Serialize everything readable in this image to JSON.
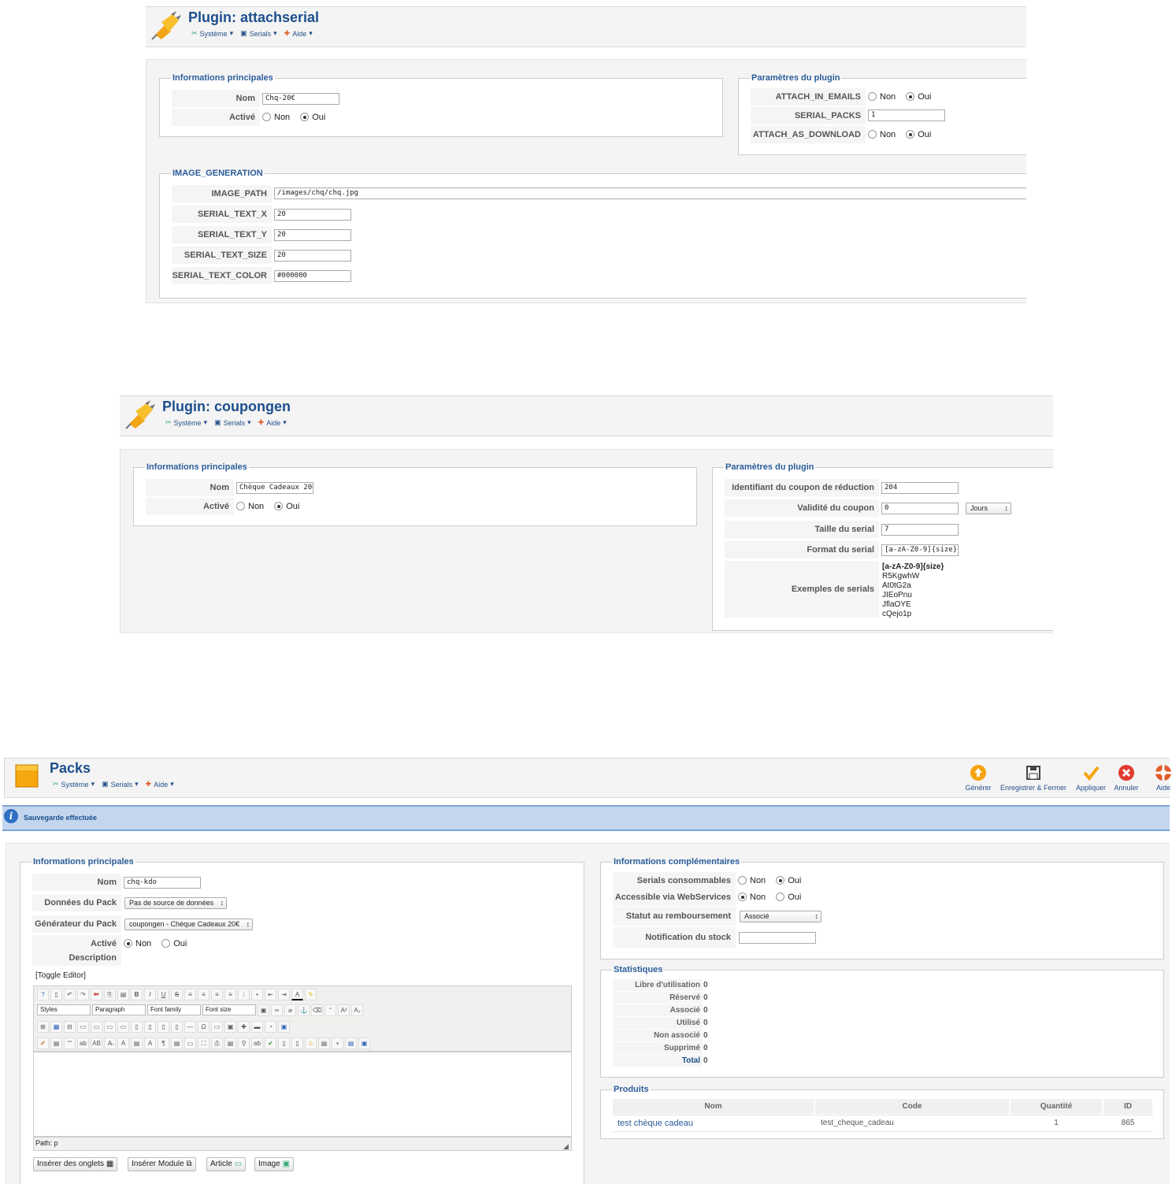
{
  "plugin1": {
    "title": "Plugin: attachserial",
    "menu": [
      "Système",
      "Serials",
      "Aide"
    ],
    "info": {
      "legend": "Informations principales",
      "nom_label": "Nom",
      "nom_value": "Chq-20€",
      "active_label": "Activé",
      "non": "Non",
      "oui": "Oui"
    },
    "params": {
      "legend": "Paramètres du plugin",
      "attach_in_emails": "ATTACH_IN_EMAILS",
      "serial_packs": "SERIAL_PACKS",
      "serial_packs_value": "1",
      "attach_as_download": "ATTACH_AS_DOWNLOAD",
      "non": "Non",
      "oui": "Oui"
    },
    "image": {
      "legend": "IMAGE_GENERATION",
      "image_path_label": "IMAGE_PATH",
      "image_path_value": "/images/chq/chq.jpg",
      "text_x_label": "SERIAL_TEXT_X",
      "text_x_value": "20",
      "text_y_label": "SERIAL_TEXT_Y",
      "text_y_value": "20",
      "text_size_label": "SERIAL_TEXT_SIZE",
      "text_size_value": "20",
      "text_color_label": "SERIAL_TEXT_COLOR",
      "text_color_value": "#000000"
    }
  },
  "plugin2": {
    "title": "Plugin: coupongen",
    "menu": [
      "Système",
      "Serials",
      "Aide"
    ],
    "info": {
      "legend": "Informations principales",
      "nom_label": "Nom",
      "nom_value": "Chèque Cadeaux 20€",
      "active_label": "Activé",
      "non": "Non",
      "oui": "Oui"
    },
    "params": {
      "legend": "Paramètres du plugin",
      "id_label": "Identifiant du coupon de réduction",
      "id_value": "204",
      "validite_label": "Validité du coupon",
      "validite_value": "0",
      "validite_unit": "Jours",
      "taille_label": "Taille du serial",
      "taille_value": "7",
      "format_label": "Format du serial",
      "format_value": "[a-zA-Z0-9]{size}",
      "exemples_label": "Exemples de serials",
      "exemples_head": "[a-zA-Z0-9]{size}",
      "exemples": [
        "R5KgwhW",
        "At0tG2a",
        "JIEoPnu",
        "JflaOYE",
        "cQejo1p"
      ]
    }
  },
  "packs": {
    "title": "Packs",
    "menu": [
      "Système",
      "Serials",
      "Aide"
    ],
    "toolbar": [
      "Générer",
      "Enregistrer & Fermer",
      "Appliquer",
      "Annuler",
      "Aide"
    ],
    "message": "Sauvegarde effectuée",
    "info": {
      "legend": "Informations principales",
      "nom_label": "Nom",
      "nom_value": "chq-kdo",
      "donnees_label": "Données du Pack",
      "donnees_value": "Pas de source de données",
      "generateur_label": "Générateur du Pack",
      "generateur_value": "coupongen - Chèque Cadeaux 20€",
      "active_label": "Activé",
      "non": "Non",
      "oui": "Oui",
      "description_label": "Description",
      "toggle": "[Toggle Editor]",
      "path": "Path: p"
    },
    "editor": {
      "styles": "Styles",
      "paragraph": "Paragraph",
      "font_family": "Font family",
      "font_size": "Font size"
    },
    "buttons": [
      "Insérer des onglets",
      "Insérer Module",
      "Article",
      "Image"
    ],
    "compl": {
      "legend": "Informations complémentaires",
      "consommables_label": "Serials consommables",
      "webservices_label": "Accessible via WebServices",
      "statut_label": "Statut au remboursement",
      "statut_value": "Associé",
      "notification_label": "Notification du stock",
      "notification_value": "",
      "non": "Non",
      "oui": "Oui"
    },
    "stats": {
      "legend": "Statistiques",
      "rows": [
        {
          "label": "Libre d'utilisation",
          "value": "0"
        },
        {
          "label": "Réservé",
          "value": "0"
        },
        {
          "label": "Associé",
          "value": "0"
        },
        {
          "label": "Utilisé",
          "value": "0"
        },
        {
          "label": "Non associé",
          "value": "0"
        },
        {
          "label": "Supprimé",
          "value": "0"
        },
        {
          "label": "Total",
          "value": "0"
        }
      ]
    },
    "produits": {
      "legend": "Produits",
      "headers": [
        "Nom",
        "Code",
        "Quantité",
        "ID"
      ],
      "row": {
        "nom": "test chèque cadeau",
        "code": "test_cheque_cadeau",
        "quantite": "1",
        "id": "865"
      }
    }
  }
}
